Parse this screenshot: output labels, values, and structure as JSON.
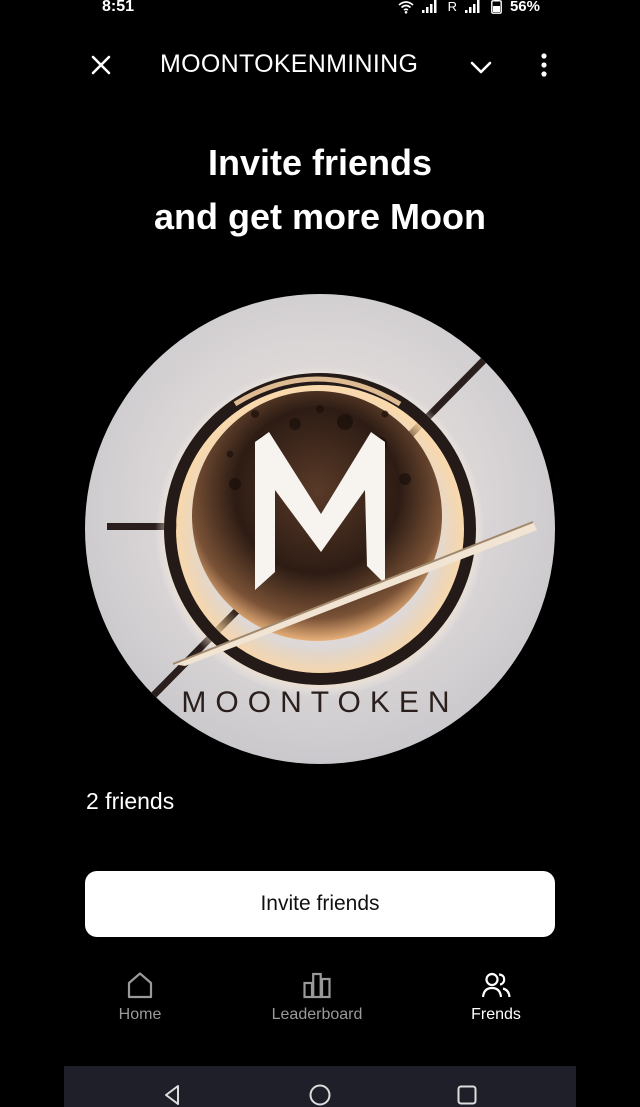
{
  "status_bar": {
    "time": "8:51",
    "roaming_label": "R",
    "battery": "56%"
  },
  "header": {
    "title": "MOONTOKENMINING",
    "close_icon": "close-icon",
    "chevron_icon": "chevron-down-icon",
    "more_icon": "more-vertical-icon"
  },
  "headline": {
    "line1": "Invite friends",
    "line2": "and get more Moon"
  },
  "logo": {
    "wordmark": "MOONTOKEN",
    "letter": "M"
  },
  "friends": {
    "count_text": "2 friends"
  },
  "invite_button": {
    "label": "Invite friends"
  },
  "tabs": [
    {
      "label": "Home",
      "icon": "home-icon",
      "active": false
    },
    {
      "label": "Leaderboard",
      "icon": "leaderboard-icon",
      "active": false
    },
    {
      "label": "Frends",
      "icon": "friends-icon",
      "active": true
    }
  ],
  "colors": {
    "background": "#000000",
    "button_bg": "#ffffff",
    "tab_inactive": "#9a9a9a",
    "nav_bar": "#1e1f29"
  }
}
